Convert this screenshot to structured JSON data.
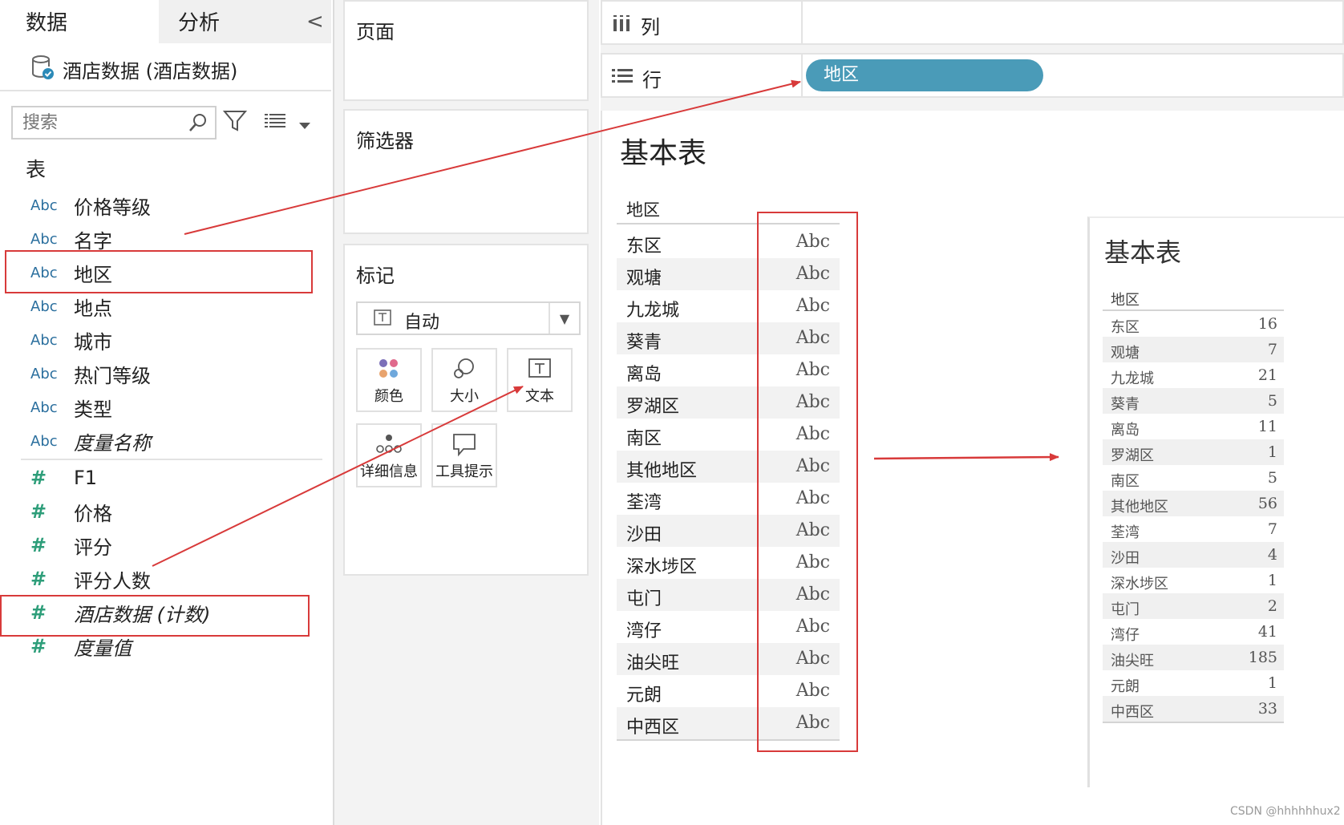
{
  "left_pane": {
    "tab_data": "数据",
    "tab_analysis": "分析",
    "collapse_glyph": "<",
    "datasource": "酒店数据 (酒店数据)",
    "search_placeholder": "搜索",
    "tables_header": "表",
    "dimensions": [
      {
        "type": "Abc",
        "name": "价格等级"
      },
      {
        "type": "Abc",
        "name": "名字"
      },
      {
        "type": "Abc",
        "name": "地区"
      },
      {
        "type": "Abc",
        "name": "地点"
      },
      {
        "type": "Abc",
        "name": "城市"
      },
      {
        "type": "Abc",
        "name": "热门等级"
      },
      {
        "type": "Abc",
        "name": "类型"
      },
      {
        "type": "Abc",
        "name": "度量名称"
      }
    ],
    "measures": [
      {
        "type": "#",
        "name": "F1"
      },
      {
        "type": "#",
        "name": "价格"
      },
      {
        "type": "#",
        "name": "评分"
      },
      {
        "type": "#",
        "name": "评分人数"
      },
      {
        "type": "#",
        "name": "酒店数据 (计数)"
      },
      {
        "type": "#",
        "name": "度量值"
      }
    ]
  },
  "shelves": {
    "pages": "页面",
    "filters": "筛选器",
    "marks": "标记",
    "marks_type": "自动",
    "mark_buttons": {
      "color": "颜色",
      "size": "大小",
      "text": "文本",
      "detail": "详细信息",
      "tooltip": "工具提示"
    },
    "columns": "列",
    "rows": "行",
    "rows_pill": "地区"
  },
  "view": {
    "title": "基本表",
    "header": "地区",
    "rows": [
      {
        "name": "东区",
        "value": "Abc"
      },
      {
        "name": "观塘",
        "value": "Abc"
      },
      {
        "name": "九龙城",
        "value": "Abc"
      },
      {
        "name": "葵青",
        "value": "Abc"
      },
      {
        "name": "离岛",
        "value": "Abc"
      },
      {
        "name": "罗湖区",
        "value": "Abc"
      },
      {
        "name": "南区",
        "value": "Abc"
      },
      {
        "name": "其他地区",
        "value": "Abc"
      },
      {
        "name": "荃湾",
        "value": "Abc"
      },
      {
        "name": "沙田",
        "value": "Abc"
      },
      {
        "name": "深水埗区",
        "value": "Abc"
      },
      {
        "name": "屯门",
        "value": "Abc"
      },
      {
        "name": "湾仔",
        "value": "Abc"
      },
      {
        "name": "油尖旺",
        "value": "Abc"
      },
      {
        "name": "元朗",
        "value": "Abc"
      },
      {
        "name": "中西区",
        "value": "Abc"
      }
    ]
  },
  "result": {
    "title": "基本表",
    "header": "地区",
    "rows": [
      {
        "name": "东区",
        "value": "16"
      },
      {
        "name": "观塘",
        "value": "7"
      },
      {
        "name": "九龙城",
        "value": "21"
      },
      {
        "name": "葵青",
        "value": "5"
      },
      {
        "name": "离岛",
        "value": "11"
      },
      {
        "name": "罗湖区",
        "value": "1"
      },
      {
        "name": "南区",
        "value": "5"
      },
      {
        "name": "其他地区",
        "value": "56"
      },
      {
        "name": "荃湾",
        "value": "7"
      },
      {
        "name": "沙田",
        "value": "4"
      },
      {
        "name": "深水埗区",
        "value": "1"
      },
      {
        "name": "屯门",
        "value": "2"
      },
      {
        "name": "湾仔",
        "value": "41"
      },
      {
        "name": "油尖旺",
        "value": "185"
      },
      {
        "name": "元朗",
        "value": "1"
      },
      {
        "name": "中西区",
        "value": "33"
      }
    ]
  },
  "watermark": "CSDN @hhhhhhux2",
  "colors": {
    "pill": "#4a9bb8",
    "annotation_red": "#d83a3a",
    "dimension_type": "#2b6f9e",
    "measure_type": "#2e9e7a"
  },
  "icons": [
    "database-icon",
    "search-icon",
    "filter-icon",
    "list-view-icon",
    "color-icon",
    "size-icon",
    "text-icon",
    "detail-icon",
    "tooltip-icon",
    "columns-icon",
    "rows-icon"
  ]
}
